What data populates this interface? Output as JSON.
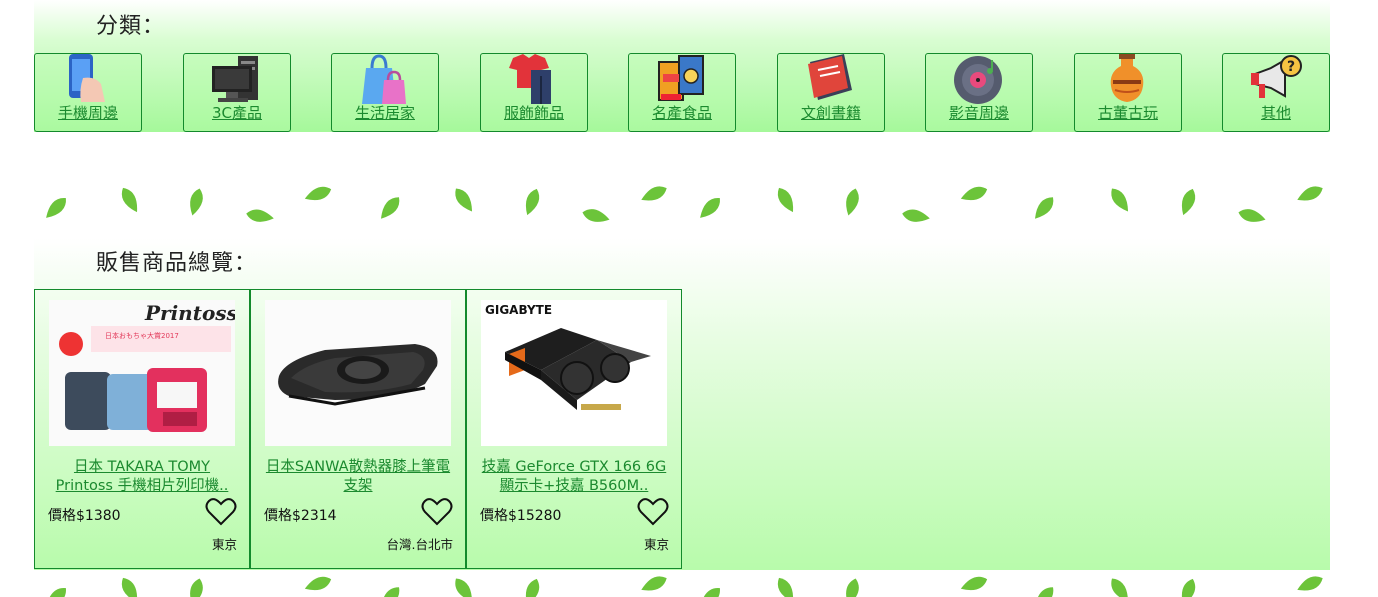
{
  "categories_heading": "分類：",
  "products_heading": "販售商品總覽：",
  "categories": [
    {
      "label": "手機周邊",
      "icon": "phone-in-hand-icon"
    },
    {
      "label": "3C產品",
      "icon": "desktop-computer-icon"
    },
    {
      "label": "生活居家",
      "icon": "shopping-bags-icon"
    },
    {
      "label": "服飾飾品",
      "icon": "clothes-icon"
    },
    {
      "label": "名產食品",
      "icon": "snack-packages-icon"
    },
    {
      "label": "文創書籍",
      "icon": "books-icon"
    },
    {
      "label": "影音周邊",
      "icon": "vinyl-record-icon"
    },
    {
      "label": "古董古玩",
      "icon": "antique-vase-icon"
    },
    {
      "label": "其他",
      "icon": "megaphone-question-icon"
    }
  ],
  "products": [
    {
      "title": "日本 TAKARA TOMY Printoss 手機相片列印機..",
      "price": "價格$1380",
      "location": "東京",
      "image": "printoss-printer-image",
      "image_brand_text": "Printoss",
      "image_caption": "日本おもちゃ大賞2017"
    },
    {
      "title": "日本SANWA散熱器膝上筆電支架",
      "price": "價格$2314",
      "location": "台灣.台北市",
      "image": "laptop-cooling-pad-image"
    },
    {
      "title": "技嘉 GeForce GTX 166 6G 顯示卡+技嘉 B560M..",
      "price": "價格$15280",
      "location": "東京",
      "image": "gigabyte-gpu-image",
      "image_brand_text": "GIGABYTE"
    }
  ],
  "colors": {
    "accent": "#138a2c",
    "link": "#1b8a2f",
    "leaf": "#6cc43a",
    "band": "#a5f89a"
  }
}
